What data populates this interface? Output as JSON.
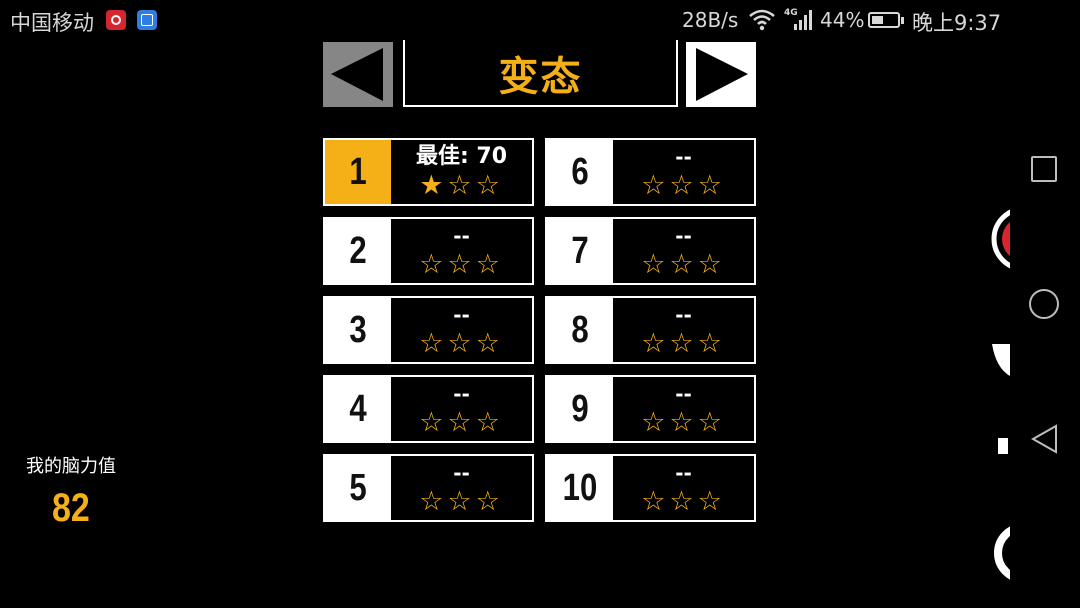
{
  "status_bar": {
    "carrier": "中国移动",
    "net_speed": "28B/s",
    "network_type": "4G",
    "battery_percent": "44%",
    "battery_level": 0.44,
    "time": "晚上9:37",
    "icons": [
      "netease-music-icon",
      "gallery-icon",
      "wifi-icon",
      "signal-icon",
      "battery-icon"
    ]
  },
  "header": {
    "title": "变态",
    "prev_icon": "triangle-left-icon",
    "next_icon": "triangle-right-icon"
  },
  "levels": [
    {
      "number": "1",
      "score": "最佳: 70",
      "stars_earned": 1,
      "stars_display": "★☆☆",
      "selected": true
    },
    {
      "number": "2",
      "score": "--",
      "stars_earned": 0,
      "stars_display": "☆☆☆",
      "selected": false
    },
    {
      "number": "3",
      "score": "--",
      "stars_earned": 0,
      "stars_display": "☆☆☆",
      "selected": false
    },
    {
      "number": "4",
      "score": "--",
      "stars_earned": 0,
      "stars_display": "☆☆☆",
      "selected": false
    },
    {
      "number": "5",
      "score": "--",
      "stars_earned": 0,
      "stars_display": "☆☆☆",
      "selected": false
    },
    {
      "number": "6",
      "score": "--",
      "stars_earned": 0,
      "stars_display": "☆☆☆",
      "selected": false
    },
    {
      "number": "7",
      "score": "--",
      "stars_earned": 0,
      "stars_display": "☆☆☆",
      "selected": false
    },
    {
      "number": "8",
      "score": "--",
      "stars_earned": 0,
      "stars_display": "☆☆☆",
      "selected": false
    },
    {
      "number": "9",
      "score": "--",
      "stars_earned": 0,
      "stars_display": "☆☆☆",
      "selected": false
    },
    {
      "number": "10",
      "score": "--",
      "stars_earned": 0,
      "stars_display": "☆☆☆",
      "selected": false
    }
  ],
  "brain": {
    "label": "我的脑力值",
    "value": "82"
  },
  "system_nav": {
    "icons": [
      "recents-icon",
      "home-icon",
      "back-icon"
    ]
  },
  "colors": {
    "accent": "#f5b017",
    "background": "#000000",
    "prev_disabled": "#868686",
    "text": "#ffffff"
  }
}
